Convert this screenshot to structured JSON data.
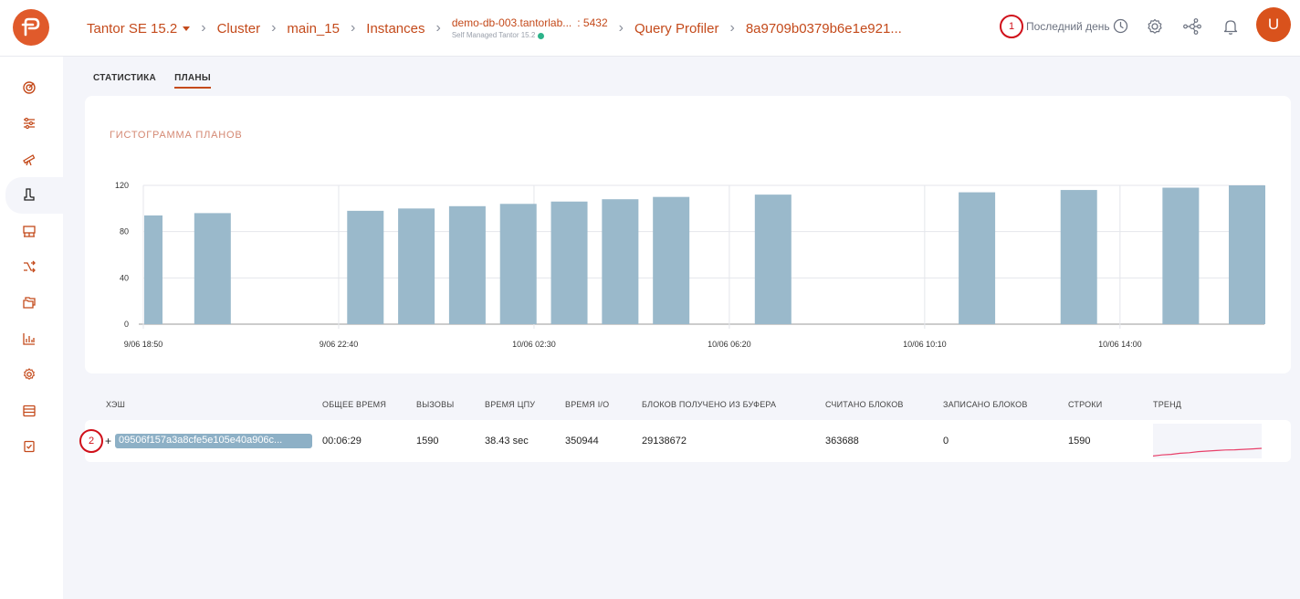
{
  "header": {
    "breadcrumbs": {
      "product": "Tantor SE 15.2",
      "cluster": "Cluster",
      "db": "main_15",
      "instances": "Instances",
      "instance_name": "demo-db-003.tantorlab...",
      "instance_port": ": 5432",
      "instance_sub": "Self Managed Tantor 15.2",
      "tool": "Query Profiler",
      "query_id": "8a9709b0379b6e1e921..."
    },
    "marker_1": "1",
    "period_label": "Последний день",
    "avatar_letter": "U"
  },
  "tabs": [
    {
      "label": "СТАТИСТИКА",
      "active": false
    },
    {
      "label": "ПЛАНЫ",
      "active": true
    }
  ],
  "chart_card": {
    "title": "ГИСТОГРАММА ПЛАНОВ"
  },
  "chart_data": {
    "type": "bar",
    "x_tick_labels": [
      "9/06 18:50",
      "9/06 22:40",
      "10/06 02:30",
      "10/06 06:20",
      "10/06 10:10",
      "10/06 14:00"
    ],
    "x": [
      "9/06 18:50",
      "9/06 19:30",
      "9/06 22:40",
      "9/06 23:40",
      "9/06 00:40",
      "10/06 01:40",
      "10/06 02:40",
      "10/06 03:40",
      "10/06 04:40",
      "10/06 06:40",
      "10/06 10:40",
      "10/06 12:40",
      "10/06 14:40",
      "10/06 16:40"
    ],
    "values": [
      94,
      96,
      98,
      100,
      102,
      104,
      106,
      108,
      110,
      112,
      114,
      116,
      118,
      120
    ],
    "bar_centers_hours": [
      0.0,
      1.0,
      4.0,
      5.0,
      6.0,
      7.0,
      8.0,
      9.0,
      10.0,
      12.0,
      16.0,
      18.0,
      20.0,
      22.0
    ],
    "y_ticks": [
      0,
      40,
      80,
      120
    ],
    "ylim": [
      0,
      120
    ],
    "grid": true,
    "bar_color": "#9ab9cb"
  },
  "table": {
    "headers": [
      "ХЭШ",
      "ОБЩЕЕ ВРЕМЯ",
      "ВЫЗОВЫ",
      "ВРЕМЯ ЦПУ",
      "ВРЕМЯ I/O",
      "БЛОКОВ ПОЛУЧЕНО ИЗ БУФЕРА",
      "СЧИТАНО БЛОКОВ",
      "ЗАПИСАНО БЛОКОВ",
      "СТРОКИ",
      "ТРЕНД"
    ],
    "rows": [
      {
        "marker": "2",
        "expand": "+",
        "hash": "09506f157a3a8cfe5e105e40a906c...",
        "total_time": "00:06:29",
        "calls": "1590",
        "cpu_time": "38.43 sec",
        "io_time": "350944",
        "buffer_hits": "29138672",
        "blocks_read": "363688",
        "blocks_written": "0",
        "rows": "1590",
        "trend": [
          0.05,
          0.15,
          0.2,
          0.3,
          0.35,
          0.45,
          0.5,
          0.55,
          0.6,
          0.62,
          0.66,
          0.7,
          0.75
        ]
      }
    ]
  },
  "colors": {
    "accent": "#c44a1b",
    "logo": "#e05a2b",
    "avatar": "#d9521c",
    "marker": "#d0101a",
    "trend_line": "#e8406a"
  },
  "icons": {
    "header": [
      "clock-icon",
      "settings-icon",
      "topology-icon",
      "bell-icon"
    ],
    "sidebar": [
      "dashboard-icon",
      "sliders-icon",
      "telescope-icon",
      "profiler-icon",
      "inventory-icon",
      "shuffle-icon",
      "folders-icon",
      "bar-chart-icon",
      "gear-icon",
      "database-list-icon",
      "checklist-icon"
    ]
  }
}
